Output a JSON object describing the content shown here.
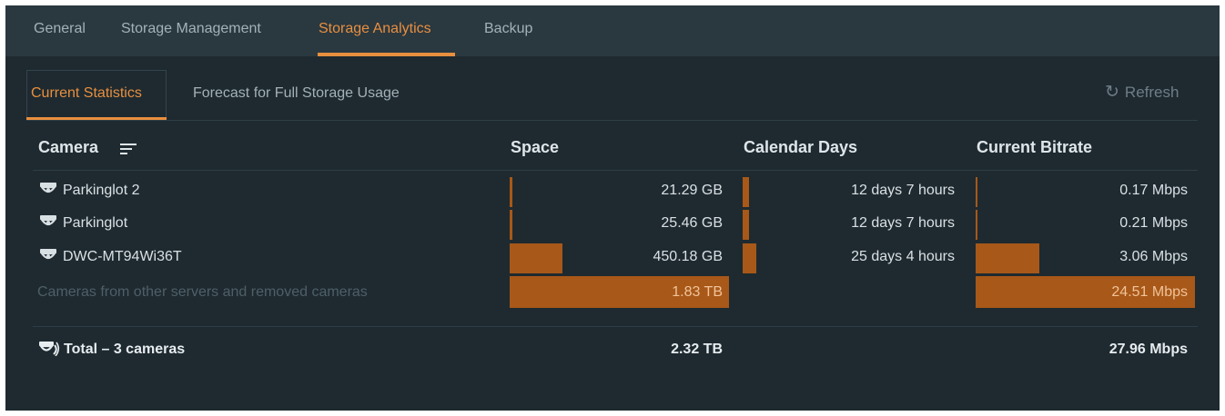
{
  "colors": {
    "accent": "#e88f3f",
    "bar": "#a85818",
    "background": "#1e2a30",
    "tabbar": "#2a3840"
  },
  "top_tabs": [
    "General",
    "Storage Management",
    "Storage Analytics",
    "Backup"
  ],
  "top_tabs_active": "Storage Analytics",
  "sub_tabs": [
    "Current Statistics",
    "Forecast for Full Storage Usage"
  ],
  "sub_tabs_active": "Current Statistics",
  "refresh": {
    "icon": "refresh-icon",
    "label": "Refresh"
  },
  "columns": {
    "camera": "Camera",
    "space": "Space",
    "days": "Calendar Days",
    "bitrate": "Current Bitrate",
    "camera_sort_icon": "sort-icon"
  },
  "rows": [
    {
      "icon": "camera-icon",
      "name": "Parkinglot 2",
      "space": "21.29 GB",
      "days": "12 days 7 hours",
      "bitrate": "0.17 Mbps",
      "space_fraction": 0.012,
      "days_fraction": 0.03,
      "bitrate_fraction": 0.007
    },
    {
      "icon": "camera-icon",
      "name": "Parkinglot",
      "space": "25.46 GB",
      "days": "12 days 7 hours",
      "bitrate": "0.21 Mbps",
      "space_fraction": 0.014,
      "days_fraction": 0.03,
      "bitrate_fraction": 0.009
    },
    {
      "icon": "camera-icon",
      "name": "DWC-MT94Wi36T",
      "space": "450.18 GB",
      "days": "25 days 4 hours",
      "bitrate": "3.06 Mbps",
      "space_fraction": 0.24,
      "days_fraction": 0.06,
      "bitrate_fraction": 0.29
    }
  ],
  "other_row": {
    "label": "Cameras from other servers and removed cameras",
    "space": "1.83 TB",
    "bitrate": "24.51 Mbps",
    "space_fraction": 1.0,
    "bitrate_fraction": 1.0
  },
  "total": {
    "icon": "cameras-icon",
    "label": "Total – 3 cameras",
    "space": "2.32 TB",
    "bitrate": "27.96 Mbps"
  }
}
